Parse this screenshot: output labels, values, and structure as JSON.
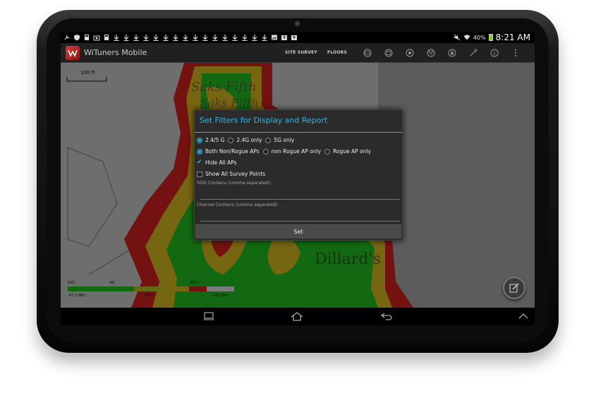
{
  "status_bar": {
    "left_icons": [
      "wrench-icon",
      "shield-icon",
      "sd-icon",
      "camera-icon",
      "sd-icon",
      "download-icon",
      "download-icon",
      "download-icon",
      "download-icon",
      "download-icon",
      "download-icon",
      "download-icon",
      "download-icon",
      "download-icon",
      "download-icon",
      "download-icon",
      "download-icon",
      "download-icon",
      "download-icon",
      "download-icon",
      "download-icon",
      "image-icon",
      "upload-icon",
      "upload-icon"
    ],
    "battery_percent": "40%",
    "time": "8:21 AM"
  },
  "action_bar": {
    "app_title": "WiTuners Mobile",
    "site_survey_label": "SITE SURVEY",
    "floors_label": "FLOORS",
    "icons": [
      "eye-icon",
      "layers-icon",
      "target-icon",
      "filter-icon",
      "lock-icon",
      "tools-icon",
      "info-icon",
      "overflow-menu-icon"
    ]
  },
  "map": {
    "scale_label": "100 ft",
    "floor_plan_labels": [
      "Saks Fifth",
      "Dillard's"
    ],
    "legend": {
      "title": "RSS",
      "top_values": [
        "-68",
        "-80.2"
      ],
      "bottom_values": [
        "-41.3 dBm",
        "-80.7",
        "-100 dBm"
      ]
    }
  },
  "dialog": {
    "title": "Set Filters for Display and Report",
    "band_options": [
      {
        "label": "2.4/5 G",
        "selected": true
      },
      {
        "label": "2.4G only",
        "selected": false
      },
      {
        "label": "5G only",
        "selected": false
      }
    ],
    "ap_options": [
      {
        "label": "Both Non/Rogue APs",
        "selected": true
      },
      {
        "label": "non Rogue AP only",
        "selected": false
      },
      {
        "label": "Rogue AP only",
        "selected": false
      }
    ],
    "hide_all_aps": {
      "label": "Hide All APs",
      "checked": true
    },
    "show_all_points": {
      "label": "Show All Survey Points",
      "checked": false
    },
    "ssid_label": "SSID Contains (comma separated):",
    "ssid_value": "",
    "channel_label": "Channel Contains (comma separated):",
    "channel_value": "",
    "set_label": "Set"
  },
  "colors": {
    "accent": "#33b5e5",
    "heat_strong": "#22c022",
    "heat_mid": "#e0c020",
    "heat_weak": "#d42020"
  }
}
